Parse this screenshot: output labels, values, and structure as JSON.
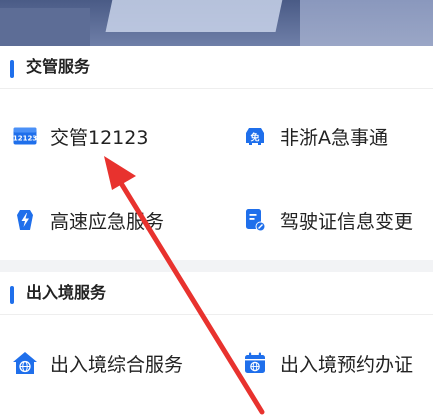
{
  "sections": [
    {
      "title": "交管服务",
      "items": [
        {
          "label": "交管12123",
          "icon": "traffic-12123-icon"
        },
        {
          "label": "非浙A急事通",
          "icon": "exemption-car-icon"
        },
        {
          "label": "高速应急服务",
          "icon": "lightning-icon"
        },
        {
          "label": "驾驶证信息变更",
          "icon": "license-edit-icon"
        }
      ]
    },
    {
      "title": "出入境服务",
      "items": [
        {
          "label": "出入境综合服务",
          "icon": "globe-home-icon"
        },
        {
          "label": "出入境预约办证",
          "icon": "calendar-globe-icon"
        }
      ]
    }
  ],
  "icon_text": {
    "traffic_12123": "12123",
    "exempt": "免"
  },
  "colors": {
    "accent": "#1f6feb",
    "arrow": "#e8322e"
  }
}
